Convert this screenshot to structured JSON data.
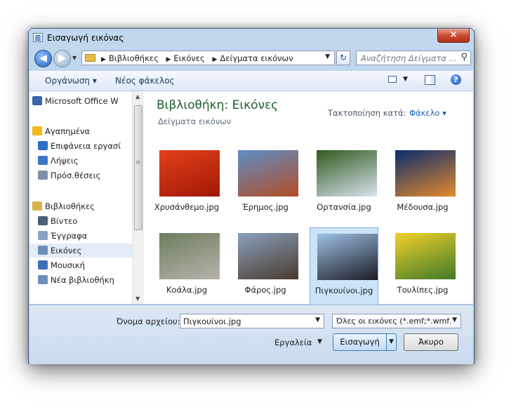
{
  "window": {
    "title": "Εισαγωγή εικόνας",
    "close_label": "✕"
  },
  "nav": {
    "breadcrumbs": [
      "Βιβλιοθήκες",
      "Εικόνες",
      "Δείγματα εικόνων"
    ],
    "search_placeholder": "Αναζήτηση Δείγματα ..."
  },
  "toolbar": {
    "organize": "Οργάνωση ▾",
    "new_folder": "Νέος φάκελος"
  },
  "sidebar": {
    "items": [
      {
        "label": "Microsoft Office W",
        "icon": "office-icon",
        "color": "#3a64a8"
      },
      {
        "label": "Αγαπημένα",
        "icon": "star-icon",
        "color": "#f2b81c"
      },
      {
        "label": "Επιφάνεια εργασί",
        "icon": "desktop-icon",
        "color": "#2d6dc7"
      },
      {
        "label": "Λήψεις",
        "icon": "downloads-icon",
        "color": "#3a75c9"
      },
      {
        "label": "Πρόσ.θέσεις",
        "icon": "recent-places-icon",
        "color": "#7e8ea4"
      },
      {
        "label": "Βιβλιοθήκες",
        "icon": "libraries-icon",
        "color": "#d8b24a"
      },
      {
        "label": "Βίντεο",
        "icon": "video-icon",
        "color": "#4c5f7a"
      },
      {
        "label": "Έγγραφα",
        "icon": "documents-icon",
        "color": "#8aa3c4"
      },
      {
        "label": "Εικόνες",
        "icon": "pictures-icon",
        "color": "#6d8fb9"
      },
      {
        "label": "Μουσική",
        "icon": "music-icon",
        "color": "#3e6fb2"
      },
      {
        "label": "Νέα βιβλιοθήκη",
        "icon": "library-icon",
        "color": "#6d8fb9"
      }
    ],
    "selected": "Εικόνες"
  },
  "content": {
    "title": "Βιβλιοθήκη: Εικόνες",
    "subtitle": "Δείγματα εικόνων",
    "arrange_label": "Τακτοποίηση κατά:",
    "arrange_value": "Φάκελο ▾",
    "files": [
      {
        "name": "Χρυσάνθεμο.jpg",
        "colors": [
          "#e2401a",
          "#a01805"
        ]
      },
      {
        "name": "Έρημος.jpg",
        "colors": [
          "#5d8ec8",
          "#b24d23"
        ]
      },
      {
        "name": "Ορτανσία.jpg",
        "colors": [
          "#2f5a1c",
          "#d9e2ee"
        ]
      },
      {
        "name": "Μέδουσα.jpg",
        "colors": [
          "#0a2c6e",
          "#e48a2c"
        ]
      },
      {
        "name": "Κοάλα.jpg",
        "colors": [
          "#6b7d5e",
          "#b8b4ac"
        ]
      },
      {
        "name": "Φάρος.jpg",
        "colors": [
          "#8aa0bd",
          "#4a3a2c"
        ]
      },
      {
        "name": "Πιγκουίνοι.jpg",
        "colors": [
          "#9cc1e4",
          "#1c1c24"
        ]
      },
      {
        "name": "Τουλίπες.jpg",
        "colors": [
          "#f3d12a",
          "#3e7a2a"
        ]
      }
    ],
    "selected_file": "Πιγκουίνοι.jpg"
  },
  "footer": {
    "filename_label": "Όνομα αρχείου:",
    "filename_value": "Πιγκουίνοι.jpg",
    "filter_value": "Όλες οι εικόνες (*.emf;*.wmf;*",
    "tools_label": "Εργαλεία",
    "insert_label": "Εισαγωγή",
    "cancel_label": "Άκυρο"
  }
}
